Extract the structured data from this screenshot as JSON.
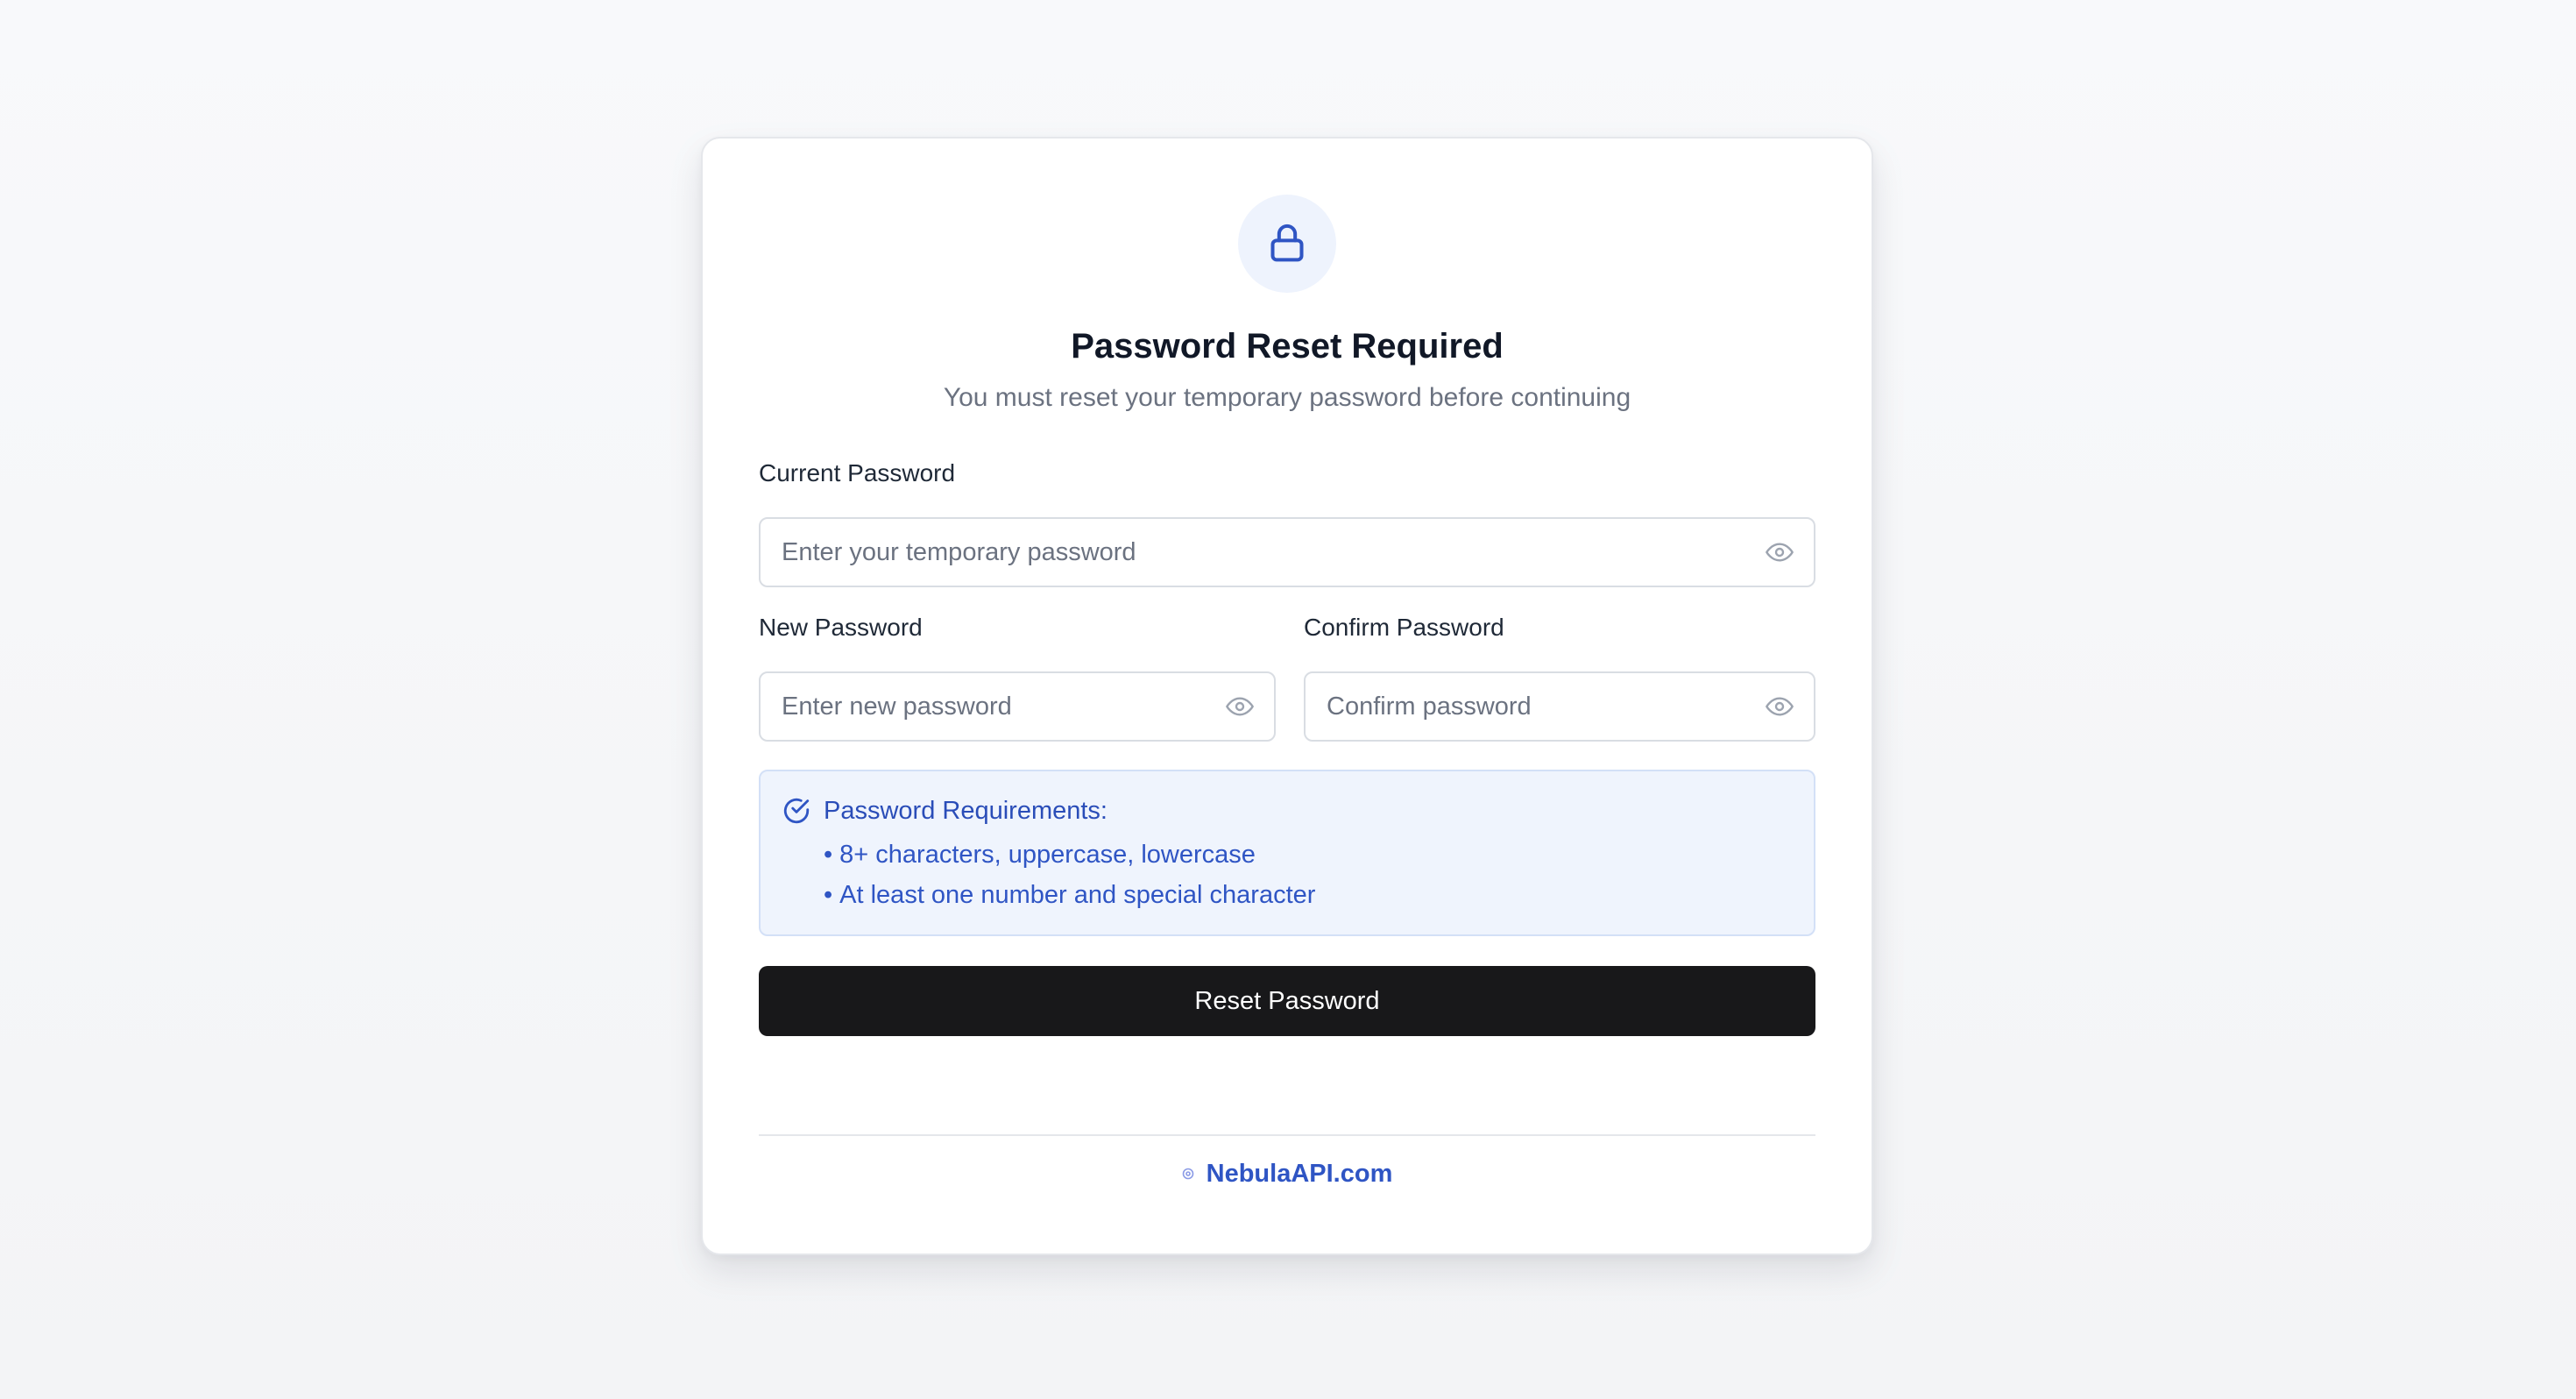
{
  "header": {
    "title": "Password Reset Required",
    "subtitle": "You must reset your temporary password before continuing",
    "icon": "lock-icon"
  },
  "form": {
    "current_password": {
      "label": "Current Password",
      "placeholder": "Enter your temporary password",
      "value": ""
    },
    "new_password": {
      "label": "New Password",
      "placeholder": "Enter new password",
      "value": ""
    },
    "confirm_password": {
      "label": "Confirm Password",
      "placeholder": "Confirm password",
      "value": ""
    },
    "toggle_icon": "eye-icon"
  },
  "requirements": {
    "icon": "check-circle-icon",
    "title": "Password Requirements:",
    "bullet": "•",
    "items": [
      "8+ characters, uppercase, lowercase",
      "At least one number and special character"
    ]
  },
  "actions": {
    "submit_label": "Reset Password"
  },
  "footer": {
    "brand": "NebulaAPI.com"
  },
  "colors": {
    "accent": "#2f55c4",
    "button": "#18181a",
    "info_bg": "#eff4fd",
    "icon_bg": "#eef3fd"
  }
}
